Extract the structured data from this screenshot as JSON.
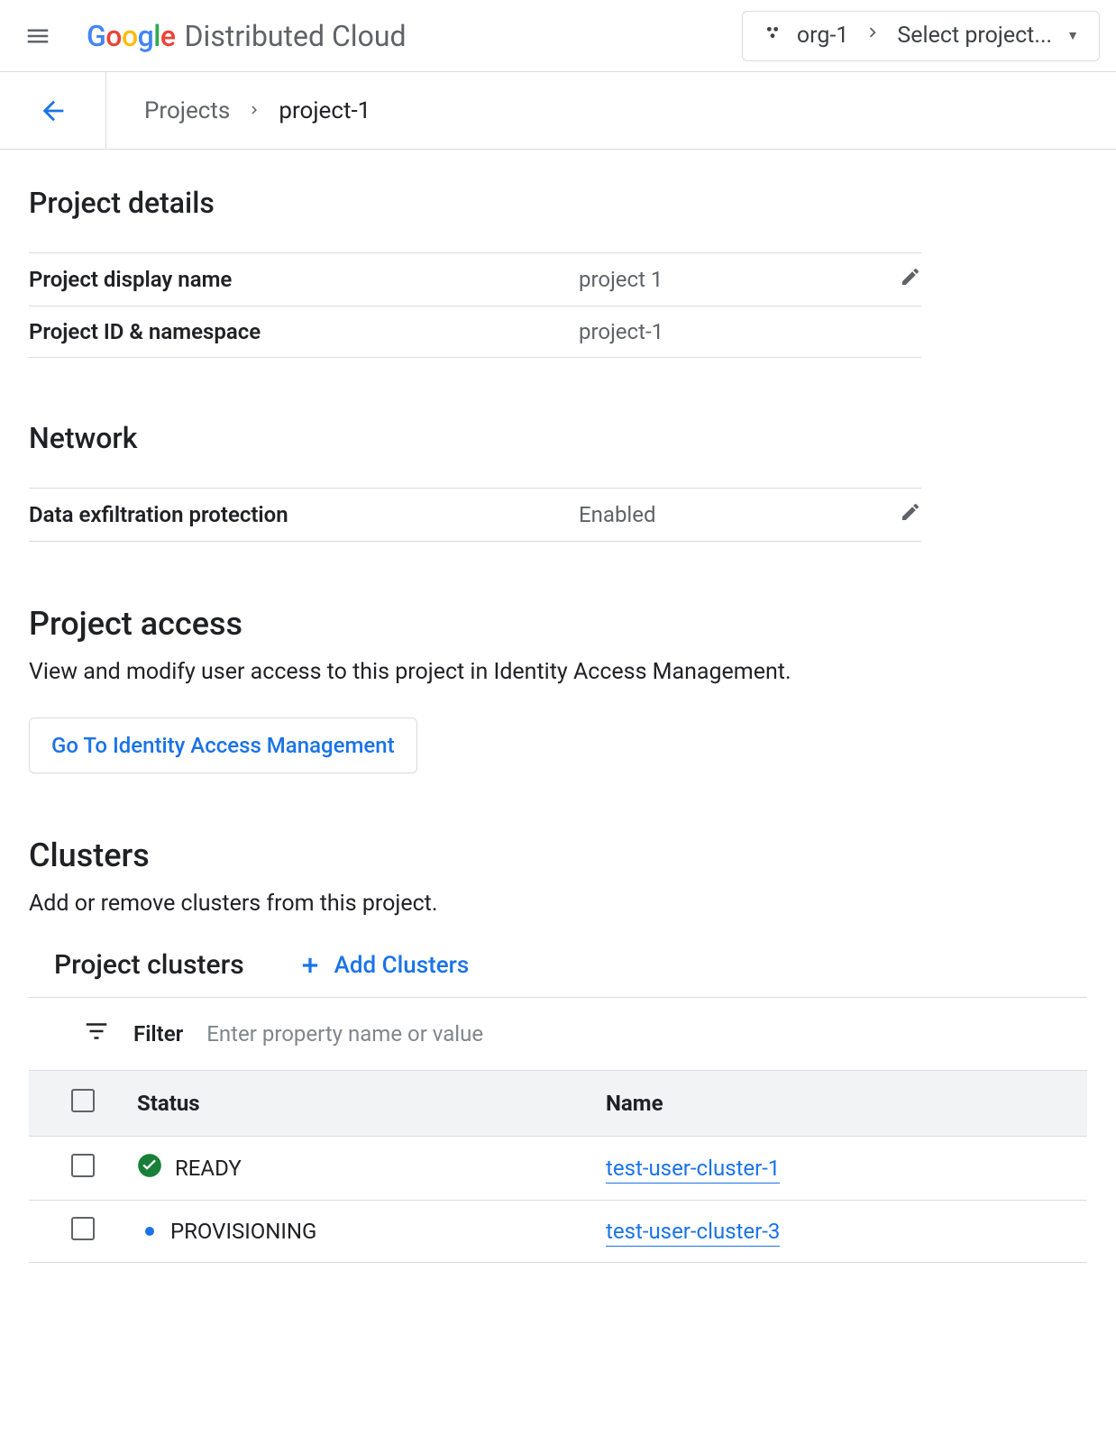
{
  "header": {
    "product_name": "Distributed Cloud",
    "org": "org-1",
    "project_placeholder": "Select project..."
  },
  "breadcrumb": {
    "root": "Projects",
    "current": "project-1"
  },
  "project_details": {
    "title": "Project details",
    "rows": [
      {
        "label": "Project display name",
        "value": "project 1",
        "editable": true
      },
      {
        "label": "Project ID & namespace",
        "value": "project-1",
        "editable": false
      }
    ]
  },
  "network": {
    "title": "Network",
    "rows": [
      {
        "label": "Data exfiltration protection",
        "value": "Enabled",
        "editable": true
      }
    ]
  },
  "access": {
    "title": "Project access",
    "desc": "View and modify user access to this project in Identity Access Management.",
    "button": "Go To Identity Access Management"
  },
  "clusters": {
    "title": "Clusters",
    "desc": "Add or remove clusters from this project.",
    "subhead": "Project clusters",
    "add_button": "Add Clusters",
    "filter_label": "Filter",
    "filter_placeholder": "Enter property name or value",
    "columns": {
      "status": "Status",
      "name": "Name"
    },
    "rows": [
      {
        "status": "READY",
        "status_kind": "ready",
        "name": "test-user-cluster-1"
      },
      {
        "status": "PROVISIONING",
        "status_kind": "prov",
        "name": "test-user-cluster-3"
      }
    ]
  }
}
